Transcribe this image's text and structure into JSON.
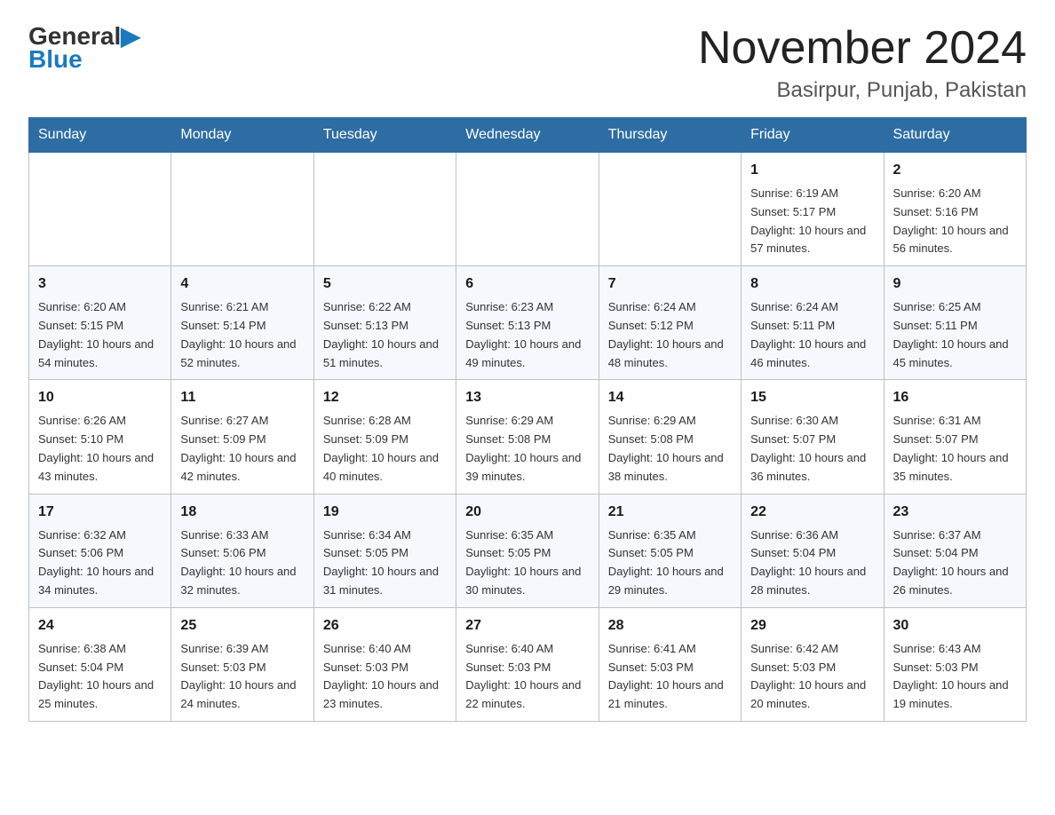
{
  "header": {
    "logo_general": "General",
    "logo_blue": "Blue",
    "month_title": "November 2024",
    "location": "Basirpur, Punjab, Pakistan"
  },
  "weekdays": [
    "Sunday",
    "Monday",
    "Tuesday",
    "Wednesday",
    "Thursday",
    "Friday",
    "Saturday"
  ],
  "weeks": [
    [
      {
        "day": "",
        "info": ""
      },
      {
        "day": "",
        "info": ""
      },
      {
        "day": "",
        "info": ""
      },
      {
        "day": "",
        "info": ""
      },
      {
        "day": "",
        "info": ""
      },
      {
        "day": "1",
        "info": "Sunrise: 6:19 AM\nSunset: 5:17 PM\nDaylight: 10 hours and 57 minutes."
      },
      {
        "day": "2",
        "info": "Sunrise: 6:20 AM\nSunset: 5:16 PM\nDaylight: 10 hours and 56 minutes."
      }
    ],
    [
      {
        "day": "3",
        "info": "Sunrise: 6:20 AM\nSunset: 5:15 PM\nDaylight: 10 hours and 54 minutes."
      },
      {
        "day": "4",
        "info": "Sunrise: 6:21 AM\nSunset: 5:14 PM\nDaylight: 10 hours and 52 minutes."
      },
      {
        "day": "5",
        "info": "Sunrise: 6:22 AM\nSunset: 5:13 PM\nDaylight: 10 hours and 51 minutes."
      },
      {
        "day": "6",
        "info": "Sunrise: 6:23 AM\nSunset: 5:13 PM\nDaylight: 10 hours and 49 minutes."
      },
      {
        "day": "7",
        "info": "Sunrise: 6:24 AM\nSunset: 5:12 PM\nDaylight: 10 hours and 48 minutes."
      },
      {
        "day": "8",
        "info": "Sunrise: 6:24 AM\nSunset: 5:11 PM\nDaylight: 10 hours and 46 minutes."
      },
      {
        "day": "9",
        "info": "Sunrise: 6:25 AM\nSunset: 5:11 PM\nDaylight: 10 hours and 45 minutes."
      }
    ],
    [
      {
        "day": "10",
        "info": "Sunrise: 6:26 AM\nSunset: 5:10 PM\nDaylight: 10 hours and 43 minutes."
      },
      {
        "day": "11",
        "info": "Sunrise: 6:27 AM\nSunset: 5:09 PM\nDaylight: 10 hours and 42 minutes."
      },
      {
        "day": "12",
        "info": "Sunrise: 6:28 AM\nSunset: 5:09 PM\nDaylight: 10 hours and 40 minutes."
      },
      {
        "day": "13",
        "info": "Sunrise: 6:29 AM\nSunset: 5:08 PM\nDaylight: 10 hours and 39 minutes."
      },
      {
        "day": "14",
        "info": "Sunrise: 6:29 AM\nSunset: 5:08 PM\nDaylight: 10 hours and 38 minutes."
      },
      {
        "day": "15",
        "info": "Sunrise: 6:30 AM\nSunset: 5:07 PM\nDaylight: 10 hours and 36 minutes."
      },
      {
        "day": "16",
        "info": "Sunrise: 6:31 AM\nSunset: 5:07 PM\nDaylight: 10 hours and 35 minutes."
      }
    ],
    [
      {
        "day": "17",
        "info": "Sunrise: 6:32 AM\nSunset: 5:06 PM\nDaylight: 10 hours and 34 minutes."
      },
      {
        "day": "18",
        "info": "Sunrise: 6:33 AM\nSunset: 5:06 PM\nDaylight: 10 hours and 32 minutes."
      },
      {
        "day": "19",
        "info": "Sunrise: 6:34 AM\nSunset: 5:05 PM\nDaylight: 10 hours and 31 minutes."
      },
      {
        "day": "20",
        "info": "Sunrise: 6:35 AM\nSunset: 5:05 PM\nDaylight: 10 hours and 30 minutes."
      },
      {
        "day": "21",
        "info": "Sunrise: 6:35 AM\nSunset: 5:05 PM\nDaylight: 10 hours and 29 minutes."
      },
      {
        "day": "22",
        "info": "Sunrise: 6:36 AM\nSunset: 5:04 PM\nDaylight: 10 hours and 28 minutes."
      },
      {
        "day": "23",
        "info": "Sunrise: 6:37 AM\nSunset: 5:04 PM\nDaylight: 10 hours and 26 minutes."
      }
    ],
    [
      {
        "day": "24",
        "info": "Sunrise: 6:38 AM\nSunset: 5:04 PM\nDaylight: 10 hours and 25 minutes."
      },
      {
        "day": "25",
        "info": "Sunrise: 6:39 AM\nSunset: 5:03 PM\nDaylight: 10 hours and 24 minutes."
      },
      {
        "day": "26",
        "info": "Sunrise: 6:40 AM\nSunset: 5:03 PM\nDaylight: 10 hours and 23 minutes."
      },
      {
        "day": "27",
        "info": "Sunrise: 6:40 AM\nSunset: 5:03 PM\nDaylight: 10 hours and 22 minutes."
      },
      {
        "day": "28",
        "info": "Sunrise: 6:41 AM\nSunset: 5:03 PM\nDaylight: 10 hours and 21 minutes."
      },
      {
        "day": "29",
        "info": "Sunrise: 6:42 AM\nSunset: 5:03 PM\nDaylight: 10 hours and 20 minutes."
      },
      {
        "day": "30",
        "info": "Sunrise: 6:43 AM\nSunset: 5:03 PM\nDaylight: 10 hours and 19 minutes."
      }
    ]
  ]
}
